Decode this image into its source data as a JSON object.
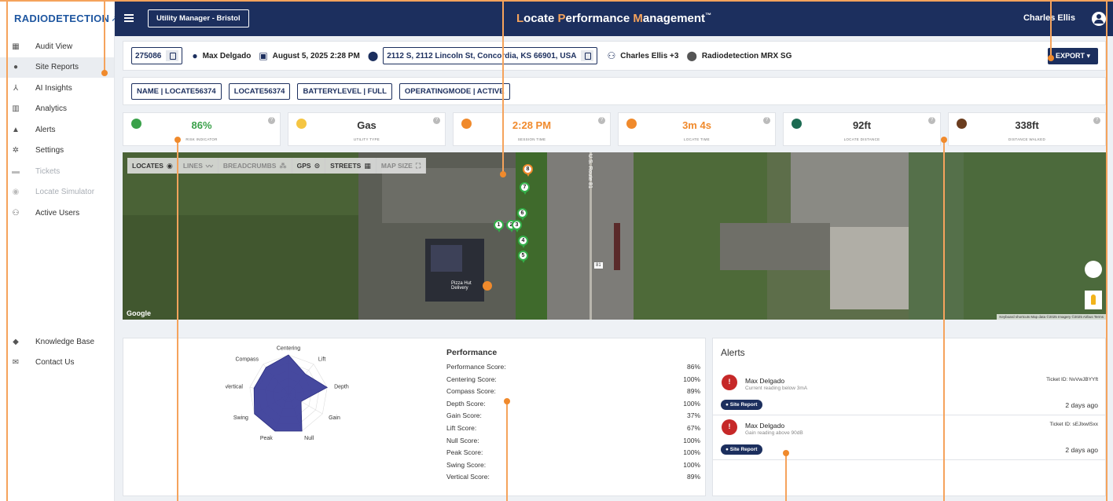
{
  "brand": {
    "name": "RADIODETECTION",
    "arrow": "➚"
  },
  "sidebar": {
    "items": [
      {
        "label": "Audit View",
        "icon": "dashboard-icon"
      },
      {
        "label": "Site Reports",
        "icon": "location-pin-icon",
        "active": true
      },
      {
        "label": "AI Insights",
        "icon": "network-icon"
      },
      {
        "label": "Analytics",
        "icon": "bar-chart-icon"
      },
      {
        "label": "Alerts",
        "icon": "bell-icon"
      },
      {
        "label": "Settings",
        "icon": "gear-icon"
      },
      {
        "label": "Tickets",
        "icon": "ticket-icon",
        "disabled": true
      },
      {
        "label": "Locate Simulator",
        "icon": "eye-icon",
        "disabled": true
      },
      {
        "label": "Active Users",
        "icon": "users-icon"
      }
    ],
    "bottom_items": [
      {
        "label": "Knowledge Base",
        "icon": "graduation-cap-icon"
      },
      {
        "label": "Contact Us",
        "icon": "mail-icon"
      }
    ]
  },
  "topbar": {
    "utility_button": "Utility Manager - Bristol",
    "title_parts": [
      "L",
      "ocate ",
      "P",
      "erformance ",
      "M",
      "anagement",
      "™"
    ],
    "user_name": "Charles Ellis"
  },
  "info": {
    "session_id": "275086",
    "locator": "Max Delgado",
    "datetime": "August 5, 2025 2:28 PM",
    "address": "2112 S, 2112 Lincoln St, Concordia, KS 66901, USA",
    "team": "Charles Ellis +3",
    "device": "Radiodetection MRX SG",
    "export_label": "EXPORT ▾"
  },
  "tags": [
    "NAME | LOCATE56374",
    "LOCATE56374",
    "BATTERYLEVEL | FULL",
    "OPERATINGMODE | ACTIVE"
  ],
  "stats": [
    {
      "value": "86%",
      "label": "RISK INDICATOR",
      "color": "#3aa14a",
      "icon_color": "#3aa14a"
    },
    {
      "value": "Gas",
      "label": "UTILITY TYPE",
      "color": "#333333",
      "icon_color": "#f5c542"
    },
    {
      "value": "2:28 PM",
      "label": "SESSION TIME",
      "color": "#f08a2c",
      "icon_color": "#f08a2c"
    },
    {
      "value": "3m 4s",
      "label": "LOCATE TIME",
      "color": "#f08a2c",
      "icon_color": "#f08a2c"
    },
    {
      "value": "92ft",
      "label": "LOCATE DISTANCE",
      "color": "#333333",
      "icon_color": "#1c6b52"
    },
    {
      "value": "338ft",
      "label": "DISTANCE WALKED",
      "color": "#333333",
      "icon_color": "#6b3d1f"
    }
  ],
  "map": {
    "toolbar": [
      {
        "label": "LOCATES",
        "icon": "◉",
        "muted": false
      },
      {
        "label": "LINES",
        "icon": "〰",
        "muted": true
      },
      {
        "label": "BREADCRUMBS",
        "icon": "⁂",
        "muted": true
      },
      {
        "label": "GPS",
        "icon": "⊙",
        "muted": false
      },
      {
        "label": "STREETS",
        "icon": "▦",
        "muted": false
      },
      {
        "label": "MAP SIZE",
        "icon": "⛶",
        "muted": true
      }
    ],
    "google": "Google",
    "terms": "Keyboard shortcuts   Map data ©2025 Imagery ©2025 Airbus   Terms",
    "poi_label": "Pizza Hut Delivery",
    "road_label": "U.S. Route 81",
    "road_shield": "81",
    "pins": [
      "1",
      "2",
      "3",
      "4",
      "5",
      "6",
      "7",
      "8"
    ]
  },
  "performance": {
    "title": "Performance",
    "rows": [
      {
        "label": "Performance Score:",
        "value": "86%"
      },
      {
        "label": "Centering Score:",
        "value": "100%"
      },
      {
        "label": "Compass Score:",
        "value": "89%"
      },
      {
        "label": "Depth Score:",
        "value": "100%"
      },
      {
        "label": "Gain Score:",
        "value": "37%"
      },
      {
        "label": "Lift Score:",
        "value": "67%"
      },
      {
        "label": "Null Score:",
        "value": "100%"
      },
      {
        "label": "Peak Score:",
        "value": "100%"
      },
      {
        "label": "Swing Score:",
        "value": "100%"
      },
      {
        "label": "Vertical Score:",
        "value": "89%"
      }
    ],
    "radar": {
      "axes": [
        "Centering",
        "Lift",
        "Depth",
        "Gain",
        "Null",
        "Peak",
        "Swing",
        "Vertical",
        "Compass"
      ],
      "values": [
        100,
        67,
        100,
        37,
        100,
        100,
        100,
        89,
        89
      ],
      "fill": "#3c3f9a"
    }
  },
  "alerts": {
    "title": "Alerts",
    "items": [
      {
        "who": "Max Delgado",
        "msg": "Current reading below 3mA",
        "ticket": "Ticket ID: NvVwJBYYft",
        "button": "Site Report",
        "ago": "2 days ago"
      },
      {
        "who": "Max Delgado",
        "msg": "Gain reading above 90dB",
        "ticket": "Ticket ID: sEJlxwlSxx",
        "button": "Site Report",
        "ago": "2 days ago"
      }
    ]
  },
  "colors": {
    "navy": "#1c2f5e",
    "accent": "#f08a2c",
    "success": "#3aa14a",
    "danger": "#c62828"
  }
}
